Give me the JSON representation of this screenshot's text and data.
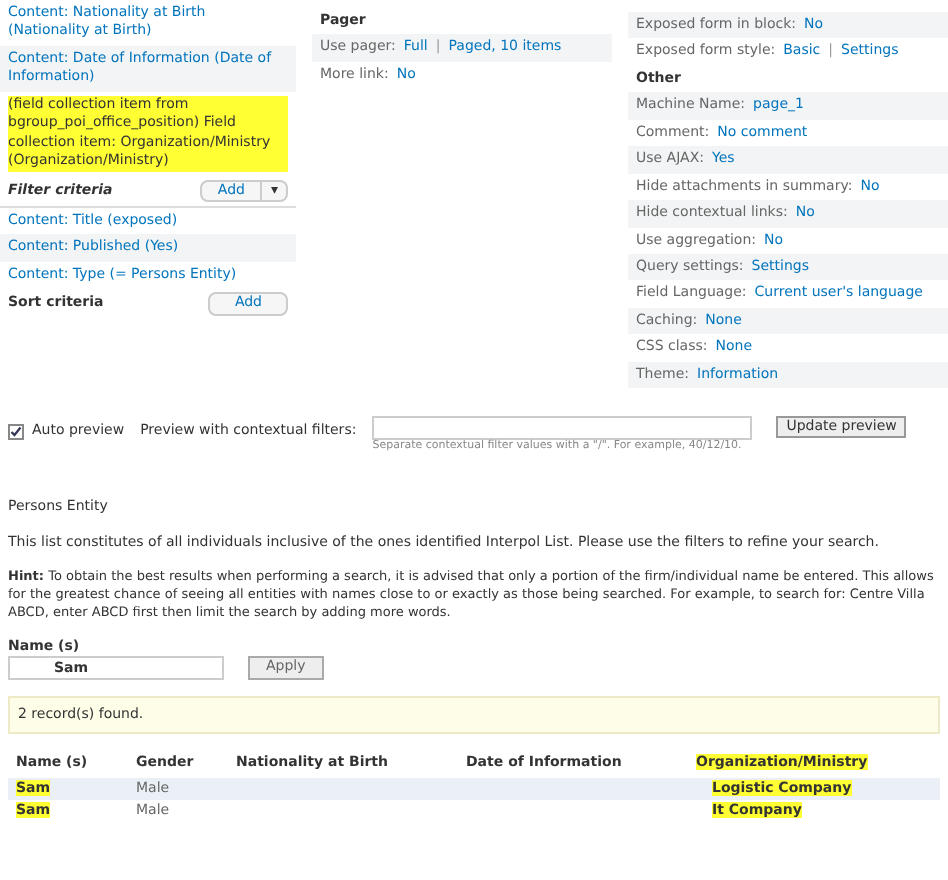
{
  "fields": [
    {
      "text": "Content: Nationality at Birth (Nationality at Birth)",
      "highlighted": false
    },
    {
      "text": "Content: Date of Information (Date of Information)",
      "highlighted": false
    },
    {
      "text": "(field collection item from bgroup_poi_office_position) Field collection item: Organization/Ministry (Organization/Ministry)",
      "highlighted": true
    }
  ],
  "filter_criteria": {
    "title": "Filter criteria",
    "add_button": "Add",
    "dropdown_caret": "▾",
    "items": [
      "Content: Title (exposed)",
      "Content: Published (Yes)",
      "Content: Type (= Persons Entity)"
    ]
  },
  "sort_criteria": {
    "title": "Sort criteria",
    "add_button": "Add"
  },
  "pager": {
    "title": "Pager",
    "settings": [
      {
        "label": "Use pager:",
        "values": [
          "Full",
          "Paged, 10 items"
        ],
        "separator": "|"
      },
      {
        "label": "More link:",
        "values": [
          "No"
        ]
      }
    ]
  },
  "exposed": [
    {
      "label": "Exposed form in block:",
      "values": [
        "No"
      ]
    },
    {
      "label": "Exposed form style:",
      "values": [
        "Basic",
        "Settings"
      ],
      "separator": "|"
    }
  ],
  "other": {
    "title": "Other",
    "settings": [
      {
        "label": "Machine Name:",
        "values": [
          "page_1"
        ]
      },
      {
        "label": "Comment:",
        "values": [
          "No comment"
        ]
      },
      {
        "label": "Use AJAX:",
        "values": [
          "Yes"
        ]
      },
      {
        "label": "Hide attachments in summary:",
        "values": [
          "No"
        ]
      },
      {
        "label": "Hide contextual links:",
        "values": [
          "No"
        ]
      },
      {
        "label": "Use aggregation:",
        "values": [
          "No"
        ]
      },
      {
        "label": "Query settings:",
        "values": [
          "Settings"
        ]
      },
      {
        "label": "Field Language:",
        "values": [
          "Current user's language"
        ]
      },
      {
        "label": "Caching:",
        "values": [
          "None"
        ]
      },
      {
        "label": "CSS class:",
        "values": [
          "None"
        ]
      },
      {
        "label": "Theme:",
        "values": [
          "Information"
        ]
      }
    ]
  },
  "preview": {
    "auto_preview": {
      "label": "Auto preview",
      "checked": true
    },
    "filters_label": "Preview with contextual filters:",
    "filters_help": "Separate contextual filter values with a \"/\". For example, 40/12/10.",
    "update_button": "Update preview"
  },
  "view": {
    "title": "Persons Entity",
    "description": "This list constitutes of all individuals inclusive of the ones identified Interpol List. Please use the filters to refine your search.",
    "hint": "**Hint:** To obtain the best results when performing a search, it is advised that only a portion of the firm/individual name be entered. This allows for the greatest chance of seeing all entities with names close to or exactly as those being searched. For example, to search for: Centre Villa ABCD, enter ABCD first then limit the search by adding more words.",
    "name_filter": {
      "label": "Name (s)",
      "value": "Sam"
    },
    "apply_button": "Apply",
    "status": "2 record(s) found.",
    "table": {
      "columns": [
        {
          "label": "Name (s)",
          "highlighted": false
        },
        {
          "label": "Gender",
          "highlighted": false
        },
        {
          "label": "Nationality at Birth",
          "highlighted": false
        },
        {
          "label": "Date of Information",
          "highlighted": false
        },
        {
          "label": "Organization/Ministry",
          "highlighted": true
        }
      ],
      "rows": [
        {
          "name": "Sam",
          "gender": "Male",
          "organization": "Logistic Company"
        },
        {
          "name": "Sam",
          "gender": "Male",
          "organization": "It Company"
        }
      ]
    }
  }
}
